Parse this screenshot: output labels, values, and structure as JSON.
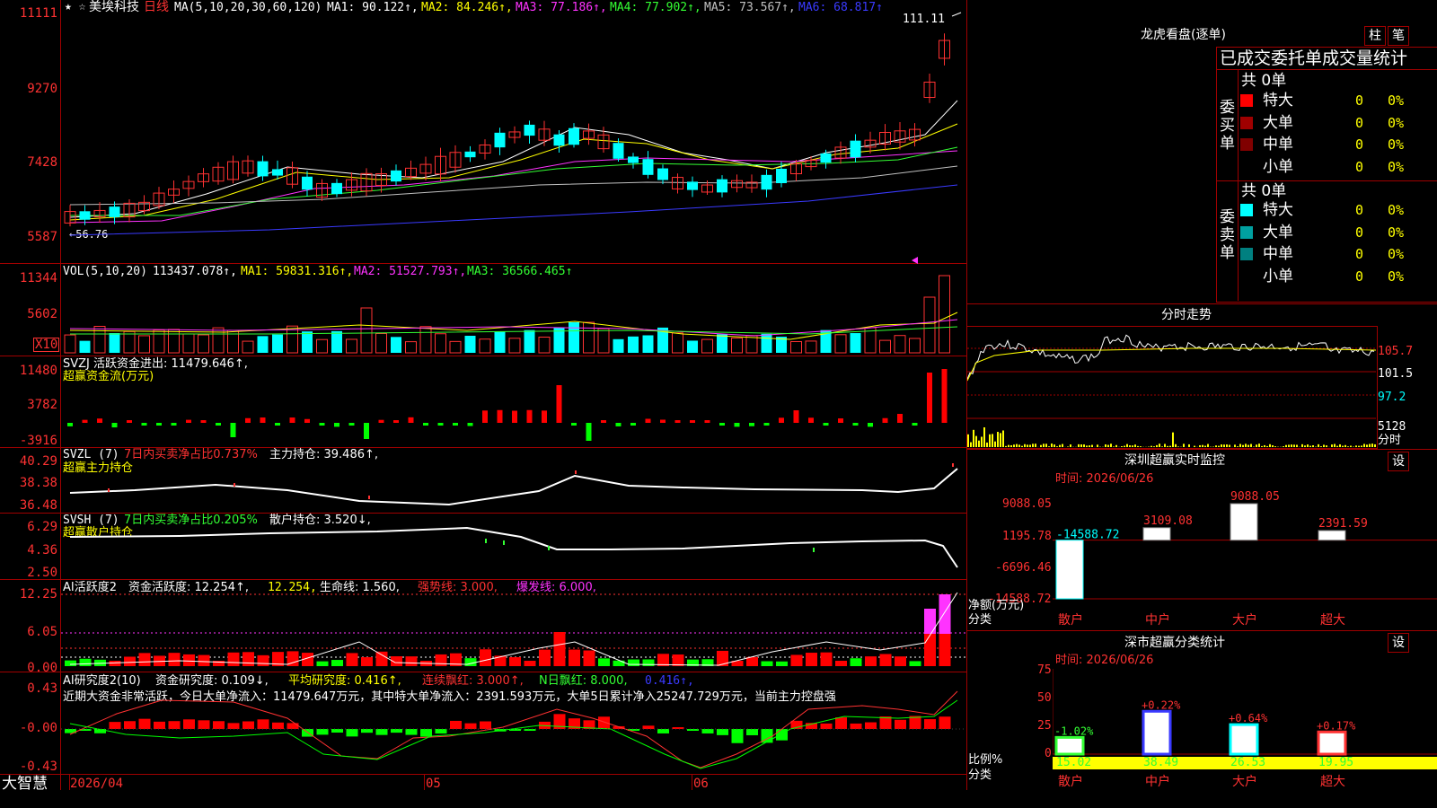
{
  "stock": {
    "name": "美埃科技",
    "period": "日线"
  },
  "ma_header": {
    "label": "MA(5,10,20,30,60,120)",
    "ma1": "MA1: 90.122↑,",
    "ma2": "MA2: 84.246↑,",
    "ma3": "MA3: 77.186↑,",
    "ma4": "MA4: 77.902↑,",
    "ma5": "MA5: 73.567↑,",
    "ma6": "MA6: 68.817↑"
  },
  "price_axis": [
    "11111",
    "9270",
    "7428",
    "5587"
  ],
  "price_high": "111.11",
  "price_low": "←56.76",
  "vol_header": {
    "label": "VOL(5,10,20)",
    "val": "113437.078↑,",
    "ma1": "MA1: 59831.316↑,",
    "ma2": "MA2: 51527.793↑,",
    "ma3": "MA3: 36566.465↑"
  },
  "vol_axis": [
    "11344",
    "5602"
  ],
  "vol_unit": "X10",
  "svzj": {
    "label": "SVZJ  活跃资金进出: 11479.646↑,",
    "sub": "超赢资金流(万元)",
    "axis": [
      "11480",
      "3782",
      "-3916"
    ]
  },
  "svzl": {
    "label": "SVZL (7)",
    "pct": "7日内买卖净占比0.737%",
    "main": "主力持仓: 39.486↑,",
    "sub": "超赢主力持仓",
    "axis": [
      "40.29",
      "38.38",
      "36.48"
    ]
  },
  "svsh": {
    "label": "SVSH (7)",
    "pct": "7日内买卖净占比0.205%",
    "main": "散户持仓: 3.520↓,",
    "sub": "超赢散户持仓",
    "axis": [
      "6.29",
      "4.36",
      "2.50"
    ]
  },
  "ai1": {
    "label": "AI活跃度2",
    "a": "资金活跃度: 12.254↑,",
    "b": "12.254,",
    "c": "生命线: 1.560,",
    "d": "强势线: 3.000,",
    "e": "爆发线: 6.000,",
    "axis": [
      "12.25",
      "6.05",
      "0.00"
    ]
  },
  "ai2": {
    "label": "AI研究度2(10)",
    "a": "资金研究度: 0.109↓,",
    "b": "平均研究度: 0.416↑,",
    "c": "连续飘红: 3.000↑,",
    "d": "N日飘红: 8.000,",
    "e": "0.416↑,",
    "text": "近期大资金非常活跃，今日大单净流入：11479.647万元，其中特大单净流入：2391.593万元，大单5日累计净入25247.729万元，当前主力控盘强",
    "axis": [
      "0.43",
      "-0.00",
      "-0.43"
    ]
  },
  "date_axis": [
    "2026/04",
    "05",
    "06"
  ],
  "brand": "大智慧",
  "longhu": {
    "title": "龙虎看盘(逐单)",
    "btn1": "柱",
    "btn2": "笔",
    "header": "已成交委托单成交量统计",
    "buy_label": "委买单",
    "sell_label": "委卖单",
    "buy_total": "共 0单",
    "sell_total": "共 0单",
    "rows": [
      "特大",
      "大单",
      "中单",
      "小单"
    ],
    "zero": "0",
    "pct": "0%",
    "buy_colors": [
      "#ff0000",
      "#a00000",
      "#800000",
      "#000000"
    ],
    "sell_colors": [
      "#00ffff",
      "#00a0a0",
      "#008080",
      "#000000"
    ]
  },
  "fenshi": {
    "title": "分时走势",
    "axis": [
      "105.7",
      "101.5",
      "97.2",
      "5128"
    ],
    "unit": "分时"
  },
  "sz_monitor": {
    "title": "深圳超赢实时监控",
    "btn": "设",
    "time": "时间: 2026/06/26",
    "axis": [
      "9088.05",
      "1195.78",
      "-6696.46",
      "-14588.72"
    ],
    "ylabel1": "净额(万元)",
    "ylabel2": "分类",
    "bars": [
      {
        "cat": "散户",
        "value": -14588.72,
        "label": "-14588.72"
      },
      {
        "cat": "中户",
        "value": 3109.08,
        "label": "3109.08"
      },
      {
        "cat": "大户",
        "value": 9088.05,
        "label": "9088.05"
      },
      {
        "cat": "超大",
        "value": 2391.59,
        "label": "2391.59"
      }
    ]
  },
  "sz_class": {
    "title": "深市超赢分类统计",
    "btn": "设",
    "time": "时间: 2026/06/26",
    "axis": [
      "75",
      "50",
      "25",
      "0"
    ],
    "ylabel1": "比例%",
    "ylabel2": "分类",
    "bars": [
      {
        "cat": "散户",
        "value": 15.02,
        "change": "-1.02%"
      },
      {
        "cat": "中户",
        "value": 38.49,
        "change": "+0.22%"
      },
      {
        "cat": "大户",
        "value": 26.53,
        "change": "+0.64%"
      },
      {
        "cat": "超大",
        "value": 19.95,
        "change": "+0.17%"
      }
    ]
  },
  "colors": {
    "grid": "#a00000",
    "up": "#ff3232",
    "down": "#00ffff",
    "ma1": "#ffffff",
    "ma2": "#ffff00",
    "ma3": "#ff33ff",
    "ma4": "#33ff33",
    "ma5": "#c0c0c0",
    "ma6": "#3a3aff"
  }
}
